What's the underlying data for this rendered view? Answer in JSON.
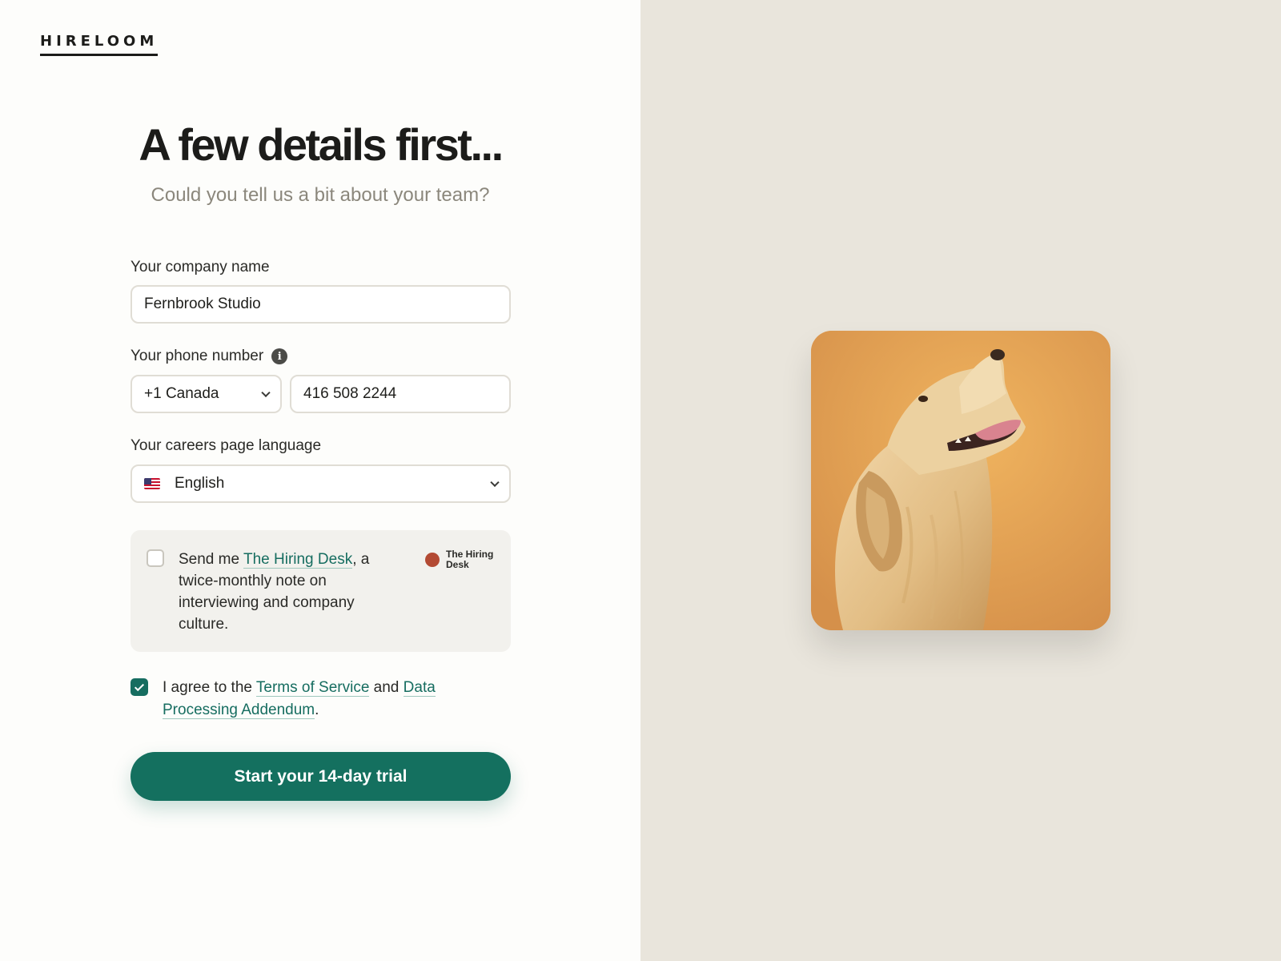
{
  "brand": {
    "logo_text": "HIRELOOM"
  },
  "header": {
    "title": "A few details first...",
    "subtitle": "Could you tell us a bit about your team?"
  },
  "form": {
    "company": {
      "label": "Your company name",
      "value": "Fernbrook Studio"
    },
    "phone": {
      "label": "Your phone number",
      "info_icon": "info-icon",
      "country_selected": "+1 Canada",
      "number_value": "416 508 2244"
    },
    "language": {
      "label": "Your careers page language",
      "flag_icon": "us-flag-icon",
      "selected": "English"
    },
    "newsletter": {
      "checked": false,
      "text_before": "Send me ",
      "link_text": "The Hiring Desk",
      "text_after": ", a twice-monthly note on interviewing and company culture.",
      "badge_label": "The Hiring Desk",
      "badge_color": "#b34a33"
    },
    "agreement": {
      "checked": true,
      "text_before": "I agree to the ",
      "terms_link": "Terms of Service",
      "text_middle": " and ",
      "dpa_link": "Data Processing Addendum",
      "text_after": "."
    },
    "submit_label": "Start your 14-day trial"
  },
  "hero_image": {
    "subject": "golden-retriever-photo"
  },
  "colors": {
    "accent": "#14705f",
    "right_panel_bg": "#e9e5dc",
    "photo_bg": "#e6a85a"
  }
}
